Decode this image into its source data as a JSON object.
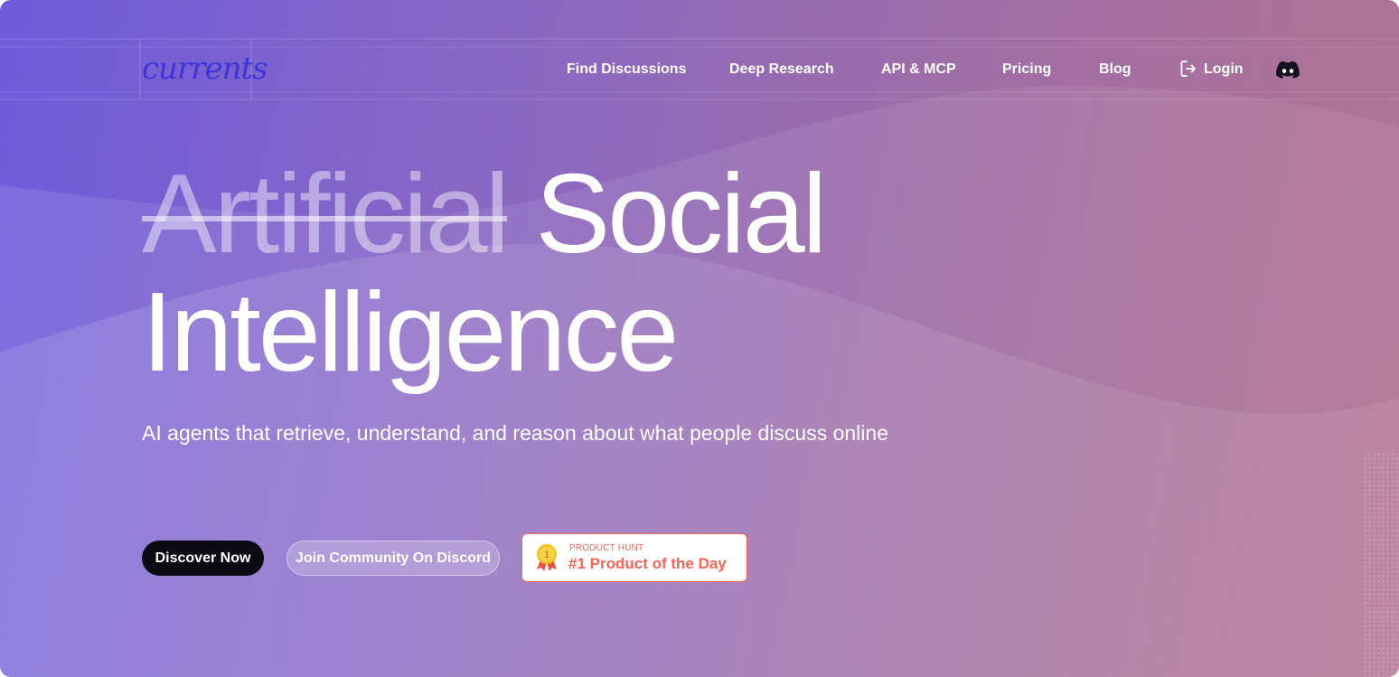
{
  "brand": {
    "logo_text": "currents",
    "logo_color": "#3e34d8"
  },
  "nav": {
    "items": [
      {
        "label": "Find Discussions"
      },
      {
        "label": "Deep Research"
      },
      {
        "label": "API & MCP"
      },
      {
        "label": "Pricing"
      },
      {
        "label": "Blog"
      }
    ],
    "login_label": "Login",
    "login_icon": "log-in-icon",
    "discord_icon": "discord-icon"
  },
  "hero": {
    "struck_word": "Artificial",
    "title_line1_rest": "Social",
    "title_line2": "Intelligence",
    "subtitle": "AI agents that retrieve, understand, and reason about what people discuss online"
  },
  "cta": {
    "primary_label": "Discover Now",
    "secondary_label": "Join Community On Discord"
  },
  "product_hunt": {
    "top_label": "PRODUCT HUNT",
    "main_label": "#1 Product of the Day",
    "medal_number": "1",
    "accent_color": "#ff6154"
  }
}
